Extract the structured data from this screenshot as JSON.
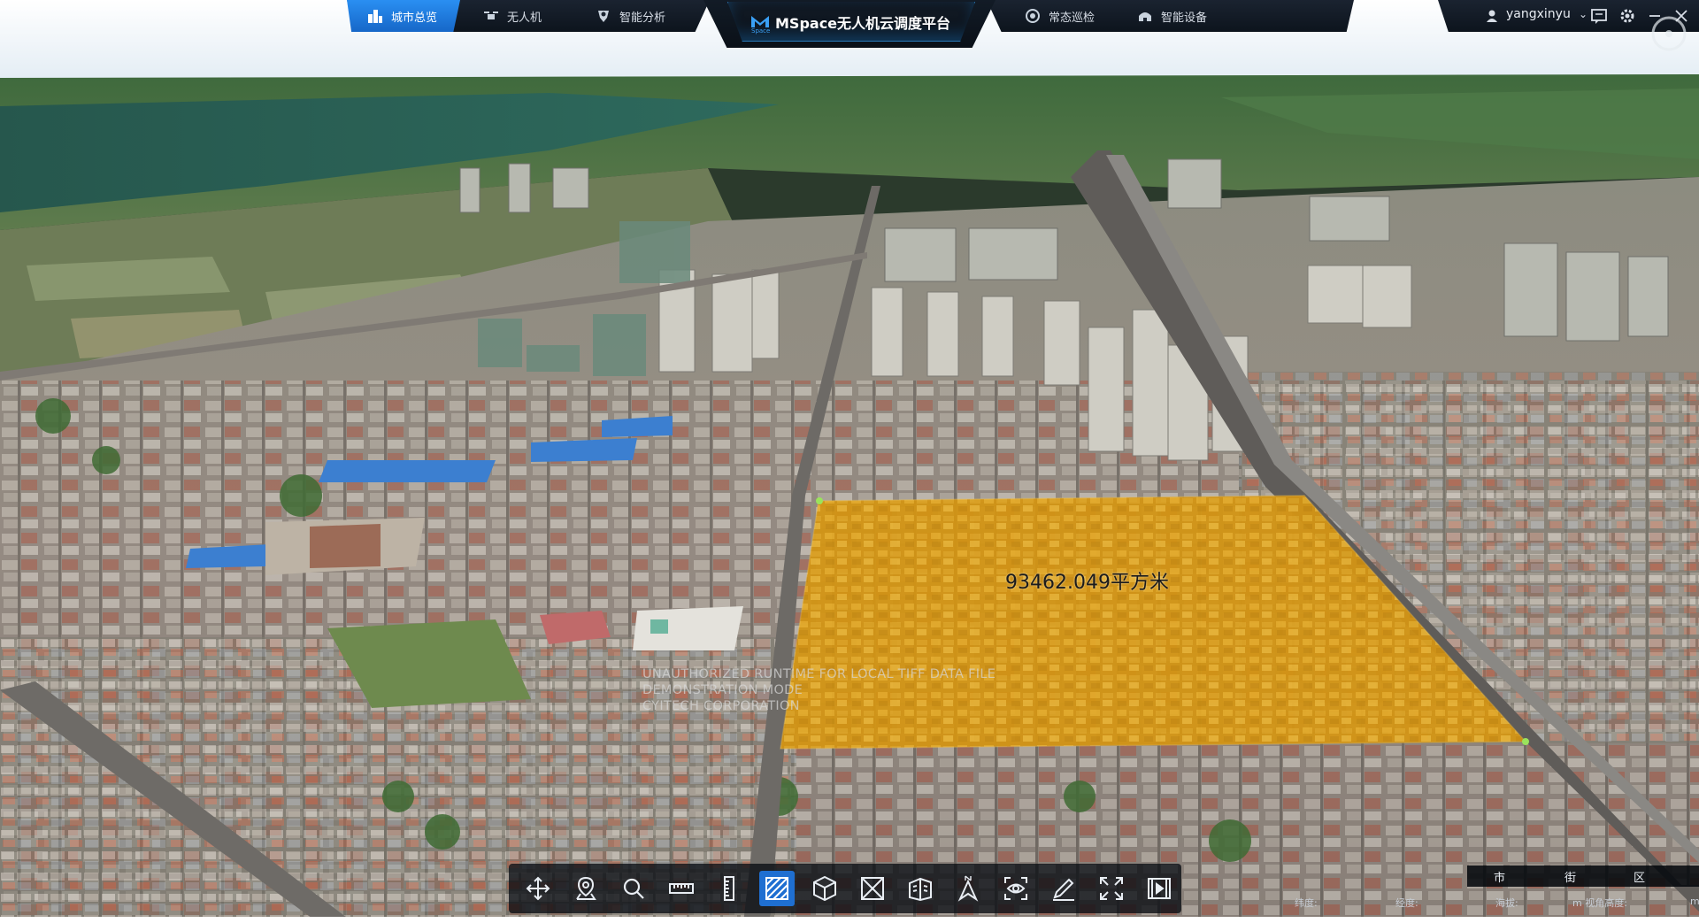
{
  "nav": {
    "tabs": [
      {
        "label": "城市总览",
        "icon": "city-overview-icon",
        "active": true
      },
      {
        "label": "无人机",
        "icon": "drone-icon",
        "active": false
      },
      {
        "label": "智能分析",
        "icon": "brain-analysis-icon",
        "active": false
      },
      {
        "label": "常态巡检",
        "icon": "patrol-icon",
        "active": false
      },
      {
        "label": "智能设备",
        "icon": "smart-device-icon",
        "active": false
      }
    ],
    "title": "MSpace无人机云调度平台",
    "logo_text": "Space"
  },
  "user": {
    "name": "yangxinyu",
    "icons": [
      "user-icon",
      "message-icon",
      "gear-icon",
      "minimize-icon",
      "close-icon"
    ]
  },
  "map": {
    "measurement": {
      "area_label": "93462.049平方米",
      "fill_color": "#e6a50a"
    },
    "watermark": [
      "UNAUTHORIZED RUNTIME FOR LOCAL TIFF DATA FILE",
      "DEMONSTRATION MODE",
      "CYITECH CORPORATION"
    ]
  },
  "toolbar": {
    "tools": [
      {
        "name": "pan-tool",
        "icon": "move-arrows-icon",
        "active": false
      },
      {
        "name": "location-tool",
        "icon": "map-pin-icon",
        "active": false
      },
      {
        "name": "search-tool",
        "icon": "search-icon",
        "active": false
      },
      {
        "name": "distance-tool",
        "icon": "ruler-icon",
        "active": false
      },
      {
        "name": "height-tool",
        "icon": "vertical-ruler-icon",
        "active": false
      },
      {
        "name": "area-tool",
        "icon": "area-measure-icon",
        "active": true
      },
      {
        "name": "volume-tool",
        "icon": "cube-icon",
        "active": false
      },
      {
        "name": "section-tool",
        "icon": "cross-section-icon",
        "active": false
      },
      {
        "name": "building-tool",
        "icon": "building-icon",
        "active": false
      },
      {
        "name": "north-tool",
        "icon": "north-arrow-icon",
        "active": false
      },
      {
        "name": "viewshed-tool",
        "icon": "eye-icon",
        "active": false
      },
      {
        "name": "draw-tool",
        "icon": "pen-icon",
        "active": false
      },
      {
        "name": "fullscreen-tool",
        "icon": "fullscreen-icon",
        "active": false
      },
      {
        "name": "video-tool",
        "icon": "play-icon",
        "active": false
      }
    ]
  },
  "scale_panel": {
    "buttons": [
      "市",
      "街",
      "区"
    ]
  },
  "status": {
    "latitude": "纬度:",
    "longitude": "经度:",
    "altitude": "海拔:",
    "view_height": "m 视角高度:",
    "tail": "m"
  }
}
